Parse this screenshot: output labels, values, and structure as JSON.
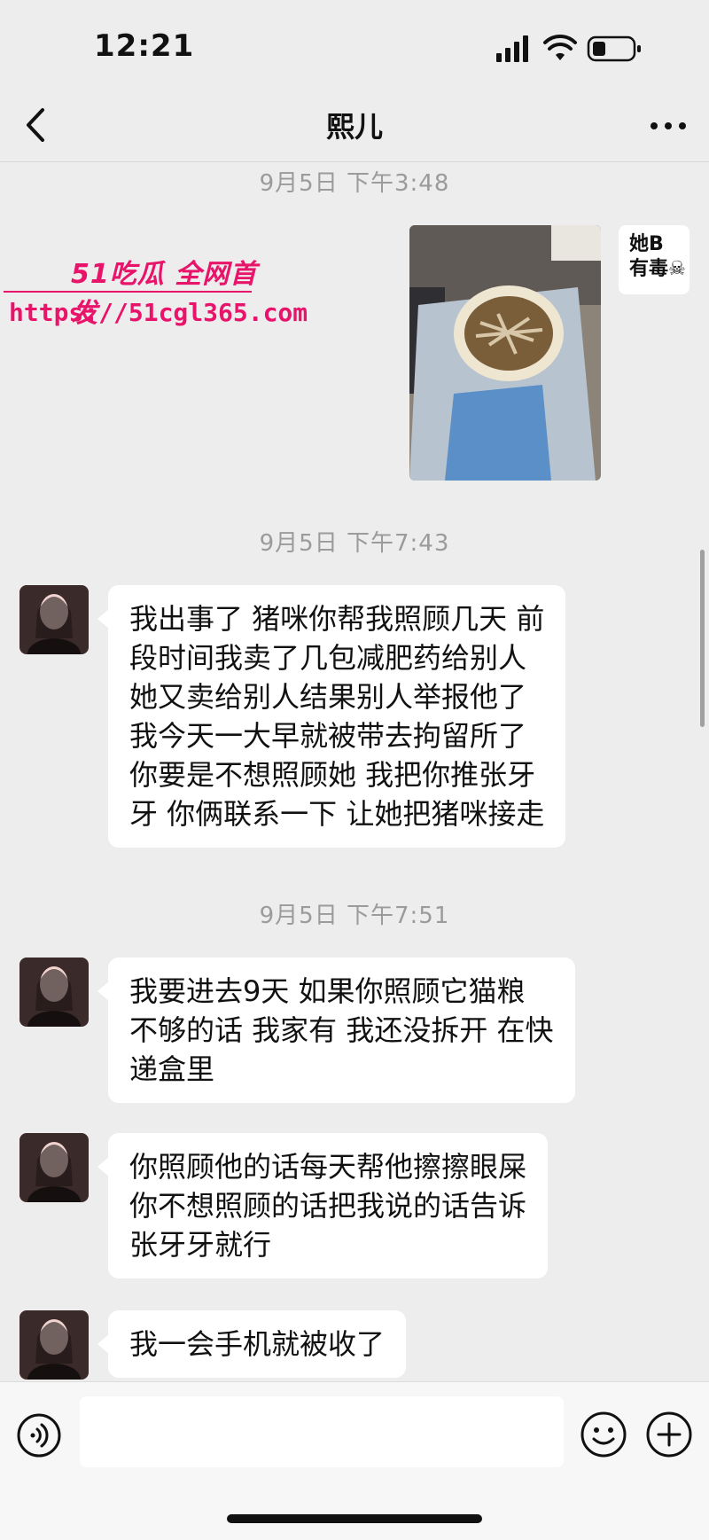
{
  "status": {
    "time": "12:21"
  },
  "header": {
    "title": "熙儿"
  },
  "watermark": {
    "brand": "51吃瓜 全网首发",
    "url": "https://51cgl365.com"
  },
  "self_avatar": {
    "text_line1": "她B",
    "text_line2": "有毒☠"
  },
  "messages": [
    {
      "time": "9月5日 下午3:48"
    },
    {
      "time": "9月5日 下午7:43",
      "text": "我出事了 猪咪你帮我照顾几天 前\n段时间我卖了几包减肥药给别人\n她又卖给别人结果别人举报他了\n我今天一大早就被带去拘留所了\n你要是不想照顾她 我把你推张牙\n牙 你俩联系一下 让她把猪咪接走"
    },
    {
      "time": "9月5日 下午7:51",
      "text": "我要进去9天 如果你照顾它猫粮\n不够的话 我家有 我还没拆开 在快\n递盒里"
    },
    {
      "text": "你照顾他的话每天帮他擦擦眼屎\n你不想照顾的话把我说的话告诉\n张牙牙就行"
    },
    {
      "text": "我一会手机就被收了"
    }
  ],
  "input": {
    "placeholder": ""
  },
  "colors": {
    "background": "#ededed",
    "bubble": "#ffffff",
    "watermark": "#e8146a"
  }
}
